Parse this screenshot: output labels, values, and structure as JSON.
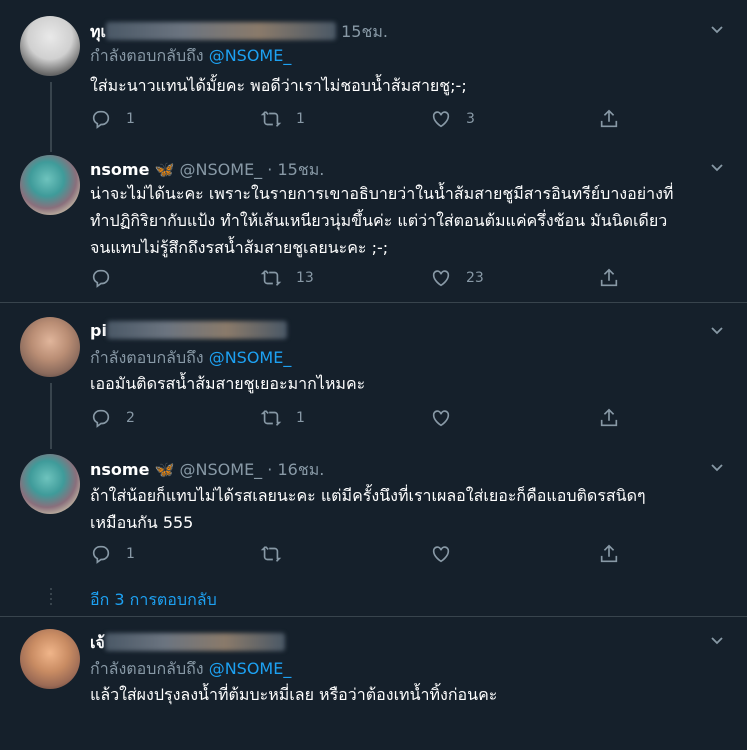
{
  "replying_to_label": "กำลังตอบกลับถึง",
  "tweets": [
    {
      "name": "ทุเ",
      "time": "15ชม.",
      "reply_to": "@NSOME_",
      "text": "ใส่มะนาวแทนได้มั้ยคะ พอดีว่าเราไม่ชอบน้ำส้มสายชู;-;",
      "reply_count": "1",
      "retweet_count": "1",
      "like_count": "3"
    },
    {
      "name": "nsome",
      "badge": "🦋",
      "handle": "@NSOME_",
      "dot": "·",
      "time": "15ชม.",
      "text_lines": [
        "น่าจะไม่ได้นะคะ เพราะในรายการเขาอธิบายว่าในน้ำส้มสายชูมีสารอินทรีย์บางอย่างที่",
        "ทำปฏิกิริยากับแป้ง ทำให้เส้นเหนียวนุ่มขึ้นค่ะ แต่ว่าใส่ตอนต้มแค่ครึ่งช้อน มันนิดเดียว",
        "จนแทบไม่รู้สึกถึงรสน้ำส้มสายชูเลยนะคะ ;-;"
      ],
      "reply_count": "",
      "retweet_count": "13",
      "like_count": "23"
    },
    {
      "name": "pi",
      "reply_to": "@NSOME_",
      "text": "เออมันติดรสน้ำส้มสายชูเยอะมากไหมคะ",
      "reply_count": "2",
      "retweet_count": "1",
      "like_count": ""
    },
    {
      "name": "nsome",
      "badge": "🦋",
      "handle": "@NSOME_",
      "dot": "·",
      "time": "16ชม.",
      "text_lines": [
        "ถ้าใส่น้อยก็แทบไม่ได้รสเลยนะคะ แต่มีครั้งนึงที่เราเผลอใส่เยอะก็คือแอบติดรสนิดๆ",
        "เหมือนกัน 555"
      ],
      "reply_count": "1",
      "retweet_count": "",
      "like_count": ""
    },
    {
      "name": "เจ้",
      "reply_to": "@NSOME_",
      "text": "แล้วใส่ผงปรุงลงน้ำที่ต้มบะหมี่เลย หรือว่าต้องเทน้ำทิ้งก่อนคะ"
    }
  ],
  "more_replies": "อีก 3 การตอบกลับ",
  "colors": {
    "background": "#15202b",
    "accent": "#1da1f2",
    "muted": "#8899a6",
    "border": "#38444d"
  },
  "icons": [
    "reply-icon",
    "retweet-icon",
    "like-icon",
    "share-icon",
    "chevron-down-icon",
    "butterfly-icon"
  ]
}
